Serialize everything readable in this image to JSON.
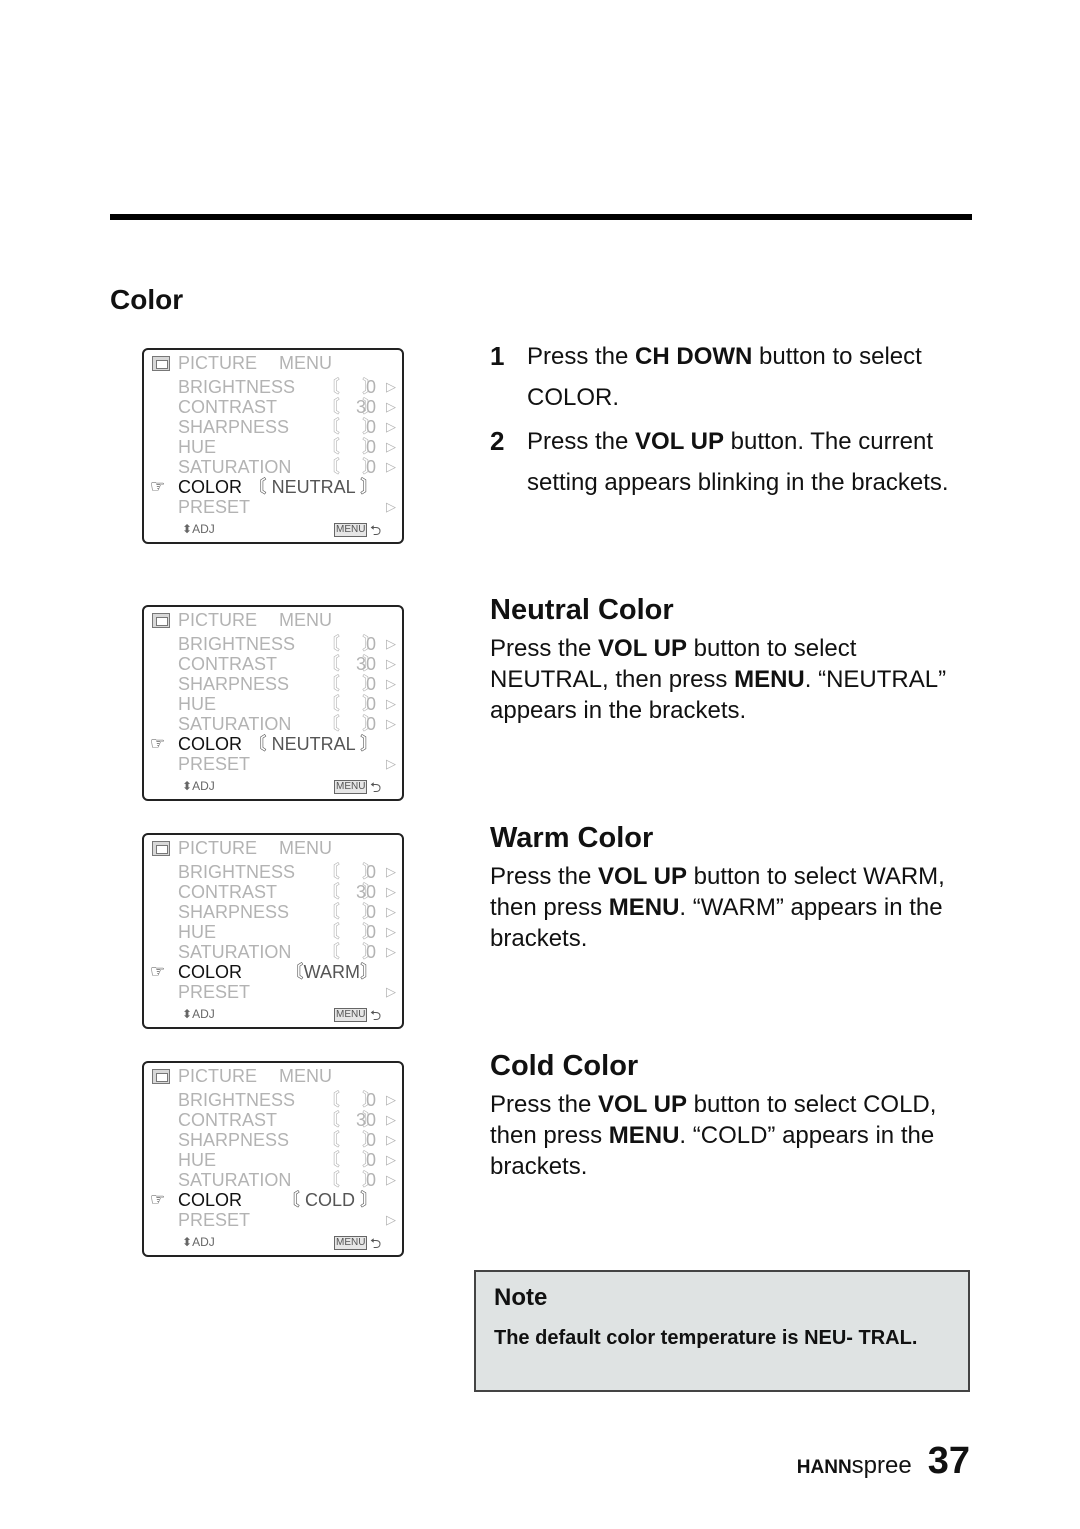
{
  "section_title": "Color",
  "osd_common": {
    "title": "PICTURE",
    "menu": "MENU",
    "rows": [
      {
        "label": "BRIGHTNESS",
        "value": "0"
      },
      {
        "label": "CONTRAST",
        "value": "30"
      },
      {
        "label": "SHARPNESS",
        "value": "0"
      },
      {
        "label": "HUE",
        "value": "0"
      },
      {
        "label": "SATURATION",
        "value": "0"
      }
    ],
    "color_label": "COLOR",
    "preset_label": "PRESET",
    "adj_label": "ADJ",
    "menu_badge": "MENU",
    "open_bracket": "〘",
    "close_bracket": "〙",
    "arrow": "▷",
    "updown": "⬍",
    "hand": "☞",
    "back": "⮌"
  },
  "osd_screens": [
    {
      "color_value": "〘 NEUTRAL 〙"
    },
    {
      "color_value": "〘 NEUTRAL 〙"
    },
    {
      "color_value": "〘WARM〙"
    },
    {
      "color_value": "〘 COLD 〙"
    }
  ],
  "steps": [
    {
      "num": "1",
      "pre": "Press the ",
      "bold": "CH DOWN",
      "post": " button to select COLOR."
    },
    {
      "num": "2",
      "pre": "Press the ",
      "bold": "VOL UP",
      "post": " button. The current setting appears blinking in the brackets."
    }
  ],
  "subsections": [
    {
      "title": "Neutral Color",
      "pre": "Press the ",
      "b1": "VOL UP",
      "mid": " button to select NEUTRAL, then press ",
      "b2": "MENU",
      "post": ". “NEUTRAL” appears in the brackets."
    },
    {
      "title": "Warm Color",
      "pre": "Press the ",
      "b1": "VOL UP",
      "mid": " button to select WARM, then press ",
      "b2": "MENU",
      "post": ". “WARM” appears in the brackets."
    },
    {
      "title": "Cold Color",
      "pre": "Press the ",
      "b1": "VOL UP",
      "mid": " button to select COLD, then press ",
      "b2": "MENU",
      "post": ". “COLD” appears in the brackets."
    }
  ],
  "note": {
    "title": "Note",
    "body": "The default color temperature is NEU- TRAL."
  },
  "footer": {
    "brand_bold": "HANN",
    "brand_light": "spree",
    "page_number": "37"
  }
}
